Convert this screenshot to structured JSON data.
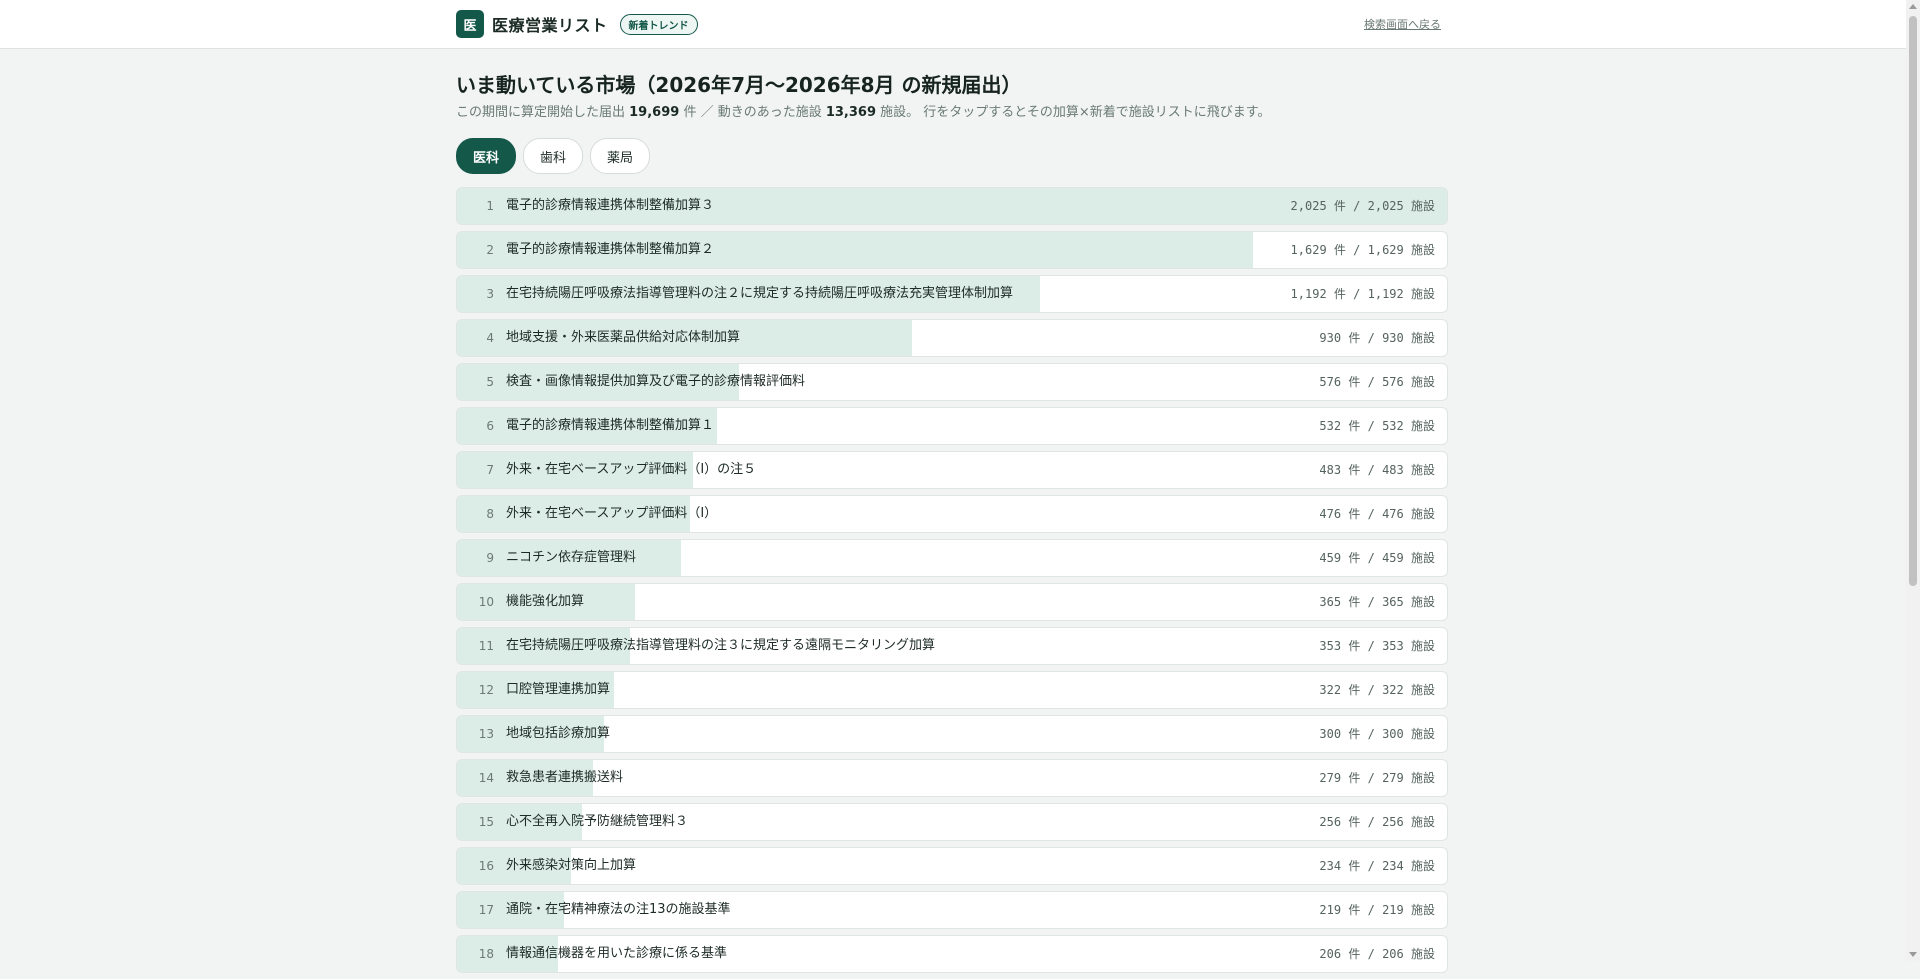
{
  "header": {
    "logo_char": "医",
    "app_title": "医療営業リスト",
    "badge": "新着トレンド",
    "back_link": "検索画面へ戻る"
  },
  "main": {
    "title": "いま動いている市場（2026年7月〜2026年8月 の新規届出）",
    "summary": {
      "prefix": "この期間に算定開始した届出 ",
      "filings_count": "19,699",
      "mid": " 件 ／ 動きのあった施設 ",
      "facilities_count": "13,369",
      "suffix": " 施設。 行をタップするとその加算×新着で施設リストに飛びます。"
    },
    "tabs": [
      {
        "label": "医科",
        "active": true
      },
      {
        "label": "歯科",
        "active": false
      },
      {
        "label": "薬局",
        "active": false
      }
    ]
  },
  "rows": [
    {
      "rank": "1",
      "name": "電子的診療情報連携体制整備加算３",
      "count": "2,025",
      "count_unit": "件",
      "sep": "/",
      "facilities": "2,025",
      "facility_unit": "施設",
      "share": 1.0
    },
    {
      "rank": "2",
      "name": "電子的診療情報連携体制整備加算２",
      "count": "1,629",
      "count_unit": "件",
      "sep": "/",
      "facilities": "1,629",
      "facility_unit": "施設",
      "share": 0.8044
    },
    {
      "rank": "3",
      "name": "在宅持続陽圧呼吸療法指導管理料の注２に規定する持続陽圧呼吸療法充実管理体制加算",
      "count": "1,192",
      "count_unit": "件",
      "sep": "/",
      "facilities": "1,192",
      "facility_unit": "施設",
      "share": 0.5886
    },
    {
      "rank": "4",
      "name": "地域支援・外来医薬品供給対応体制加算",
      "count": "930",
      "count_unit": "件",
      "sep": "/",
      "facilities": "930",
      "facility_unit": "施設",
      "share": 0.4593
    },
    {
      "rank": "5",
      "name": "検査・画像情報提供加算及び電子的診療情報評価料",
      "count": "576",
      "count_unit": "件",
      "sep": "/",
      "facilities": "576",
      "facility_unit": "施設",
      "share": 0.2844
    },
    {
      "rank": "6",
      "name": "電子的診療情報連携体制整備加算１",
      "count": "532",
      "count_unit": "件",
      "sep": "/",
      "facilities": "532",
      "facility_unit": "施設",
      "share": 0.2627
    },
    {
      "rank": "7",
      "name": "外来・在宅ベースアップ評価料（Ⅰ）の注５",
      "count": "483",
      "count_unit": "件",
      "sep": "/",
      "facilities": "483",
      "facility_unit": "施設",
      "share": 0.2385
    },
    {
      "rank": "8",
      "name": "外来・在宅ベースアップ評価料（Ⅰ）",
      "count": "476",
      "count_unit": "件",
      "sep": "/",
      "facilities": "476",
      "facility_unit": "施設",
      "share": 0.2351
    },
    {
      "rank": "9",
      "name": "ニコチン依存症管理料",
      "count": "459",
      "count_unit": "件",
      "sep": "/",
      "facilities": "459",
      "facility_unit": "施設",
      "share": 0.2267
    },
    {
      "rank": "10",
      "name": "機能強化加算",
      "count": "365",
      "count_unit": "件",
      "sep": "/",
      "facilities": "365",
      "facility_unit": "施設",
      "share": 0.1802
    },
    {
      "rank": "11",
      "name": "在宅持続陽圧呼吸療法指導管理料の注３に規定する遠隔モニタリング加算",
      "count": "353",
      "count_unit": "件",
      "sep": "/",
      "facilities": "353",
      "facility_unit": "施設",
      "share": 0.1743
    },
    {
      "rank": "12",
      "name": "口腔管理連携加算",
      "count": "322",
      "count_unit": "件",
      "sep": "/",
      "facilities": "322",
      "facility_unit": "施設",
      "share": 0.159
    },
    {
      "rank": "13",
      "name": "地域包括診療加算",
      "count": "300",
      "count_unit": "件",
      "sep": "/",
      "facilities": "300",
      "facility_unit": "施設",
      "share": 0.1481
    },
    {
      "rank": "14",
      "name": "救急患者連携搬送料",
      "count": "279",
      "count_unit": "件",
      "sep": "/",
      "facilities": "279",
      "facility_unit": "施設",
      "share": 0.1378
    },
    {
      "rank": "15",
      "name": "心不全再入院予防継続管理料３",
      "count": "256",
      "count_unit": "件",
      "sep": "/",
      "facilities": "256",
      "facility_unit": "施設",
      "share": 0.1264
    },
    {
      "rank": "16",
      "name": "外来感染対策向上加算",
      "count": "234",
      "count_unit": "件",
      "sep": "/",
      "facilities": "234",
      "facility_unit": "施設",
      "share": 0.1156
    },
    {
      "rank": "17",
      "name": "通院・在宅精神療法の注13の施設基準",
      "count": "219",
      "count_unit": "件",
      "sep": "/",
      "facilities": "219",
      "facility_unit": "施設",
      "share": 0.1081
    },
    {
      "rank": "18",
      "name": "情報通信機器を用いた診療に係る基準",
      "count": "206",
      "count_unit": "件",
      "sep": "/",
      "facilities": "206",
      "facility_unit": "施設",
      "share": 0.1017
    }
  ]
}
